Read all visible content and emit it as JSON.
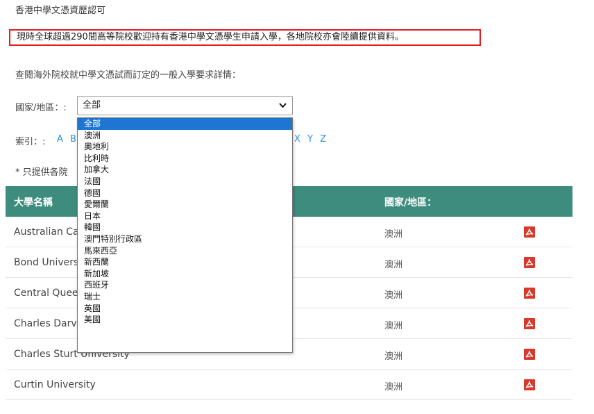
{
  "page": {
    "heading": "香港中學文憑資歷認可",
    "notice": "現時全球超過290間高等院校歡迎持有香港中學文憑學生申請入學，各地院校亦會陸續提供資料。",
    "intro": "查閱海外院校就中學文憑試而訂定的一般入學要求詳情："
  },
  "filter": {
    "country_label": "國家/地區：:",
    "selected": "全部",
    "options": [
      "全部",
      "澳洲",
      "奧地利",
      "比利時",
      "加拿大",
      "法國",
      "德國",
      "愛爾蘭",
      "日本",
      "韓國",
      "澳門特別行政區",
      "馬來西亞",
      "新西蘭",
      "新加坡",
      "西班牙",
      "瑞士",
      "英國",
      "美國"
    ]
  },
  "index": {
    "label": "索引：:",
    "letters_visible_left": "A B",
    "letters_visible_right": "X Y Z"
  },
  "footnote": "* 只提供各院",
  "table": {
    "headers": {
      "name": "大學名稱",
      "country": "國家/地區："
    },
    "rows": [
      {
        "name": "Australian Ca",
        "country": "澳洲",
        "icon": "pdf-icon"
      },
      {
        "name": "Bond Univers",
        "country": "澳洲",
        "icon": "pdf-icon"
      },
      {
        "name": "Central Quee",
        "country": "澳洲",
        "icon": "pdf-icon"
      },
      {
        "name": "Charles Darv",
        "country": "澳洲",
        "icon": "pdf-icon"
      },
      {
        "name": "Charles Sturt University",
        "country": "澳洲",
        "icon": "pdf-icon"
      },
      {
        "name": "Curtin University",
        "country": "澳洲",
        "icon": "pdf-icon"
      }
    ]
  },
  "colors": {
    "accent": "#3d8c7e",
    "notice_border": "#e02020",
    "link": "#2a8fd6",
    "selection": "#1e76d2",
    "pdf": "#d8392b"
  }
}
